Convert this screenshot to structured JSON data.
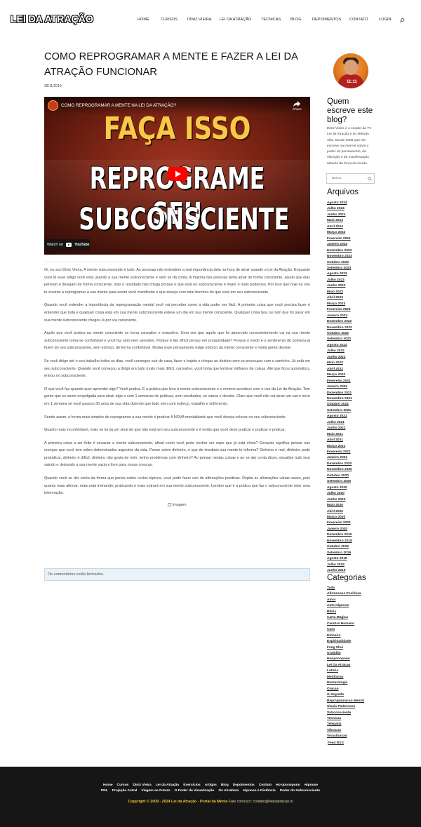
{
  "site": {
    "logo": "LEI DA ATRAÇÃO"
  },
  "nav": {
    "items": [
      "Home",
      "Cursos",
      "Diniz Vieira",
      "Lei da Atração",
      "Tecnicas",
      "Blog",
      "Depoimentos",
      "Contato",
      "Login"
    ]
  },
  "post": {
    "title": "COMO REPROGRAMAR A MENTE E FAZER A LEI DA ATRAÇÃO FUNCIONAR",
    "date": "28/11/2019"
  },
  "video": {
    "title": "COMO REPROGRAMAR A MENTE NA LEI DA ATRAÇÃO?",
    "share_label": "Share",
    "line1": "FAÇA ISSO",
    "line2": "REPROGRAME SEU",
    "line3": "SUBCONSCIENTE",
    "watch_on": "Watch on",
    "youtube": "YouTube",
    "colors": {
      "headline_yellow": "#f7c948",
      "bg_red": "#7a2414",
      "play_red": "#ff0000"
    }
  },
  "article": {
    "paragraphs": [
      "Oi, eu sou Diniz Vieira. A mente subconsciente é tudo. As pessoas não entendem a real importância dela na hora de atrair usando a Lei da Atração. Enquanto você lê esse artigo você está usando a sua mente subconsciente e nem se dá conta. A maioria das pessoas tenta atrair de forma consciente, aquilo que elas pensam e desejam de forma consciente, mas o resultado não chega porque o que está no subconsciente é maior e mais poderoso. Por isso que hoje eu vou te ensinar a reprogramar a sua mente para assim você manifestar o que deseja com total domínio do que está em seu subconsciente.",
      "Quando você entender a importância da reprogramação mental você vai perceber como a vida poder ser fácil. A primeira coisa que você precisa fazer é entender que toda e qualquer coisa está em sua mente subconsciente esteve um dia em sua mente consciente. Qualquer coisa boa ou ruim que foi parar em sua mente subconsciente chegou lá por via consciente.",
      "Aquilo que você pratica na mente consciente se torna cansativo e exaustivo. Uma vez que aquilo que foi absorvido conscientemente cai na sua mente subconsciente torna-se confortável e você faz sem nem perceber. Porque é tão difícil pensar em prosperidade? Porque o medo e o sentimento de pobreza já fluem do seu subconsciente, sem esforço, de forma confortável. Mudar esse pensamento exige esforço da mente consciente e muita gente desiste.",
      "Se você dirige até o seu trabalho todos os dias, você consegue sair de casa, fazer o trajeto e chegar ao destino sem se preocupar com o caminho. Já está em seu subconsciente. Quando você começou a dirigir era tudo muito mais difícil, cansativo, você tinha que lembrar milhares de coisas. Até que ficou automático, entrou no subconsciente.",
      "O que você faz quando quer aprender algo? Você pratica. É a prática que leva à mente subconsciente e o mesmo acontece com o uso da Lei da Atração. Tem gente que se sente empolgada para atrair algo e com 1 semanas de práticas, sem resultados, se cansa e desiste. Claro que você não vai atrair um carro novo em 1 semana se você passou 30 anos de sua vida dizendo que tudo vem com esforço, trabalho e sofrimento.",
      "Sendo assim, a forma mais simples de reprogramar a sua mente é praticar A NOVA mentalidade que você deseja colocar no seu subconsciente.",
      "Quanto mais inconfortável, mais se torna um sinal de que não está em seu subconsciente e é então que você deve praticar e praticar e praticar.",
      "A primeira coisa a ser feita é esvaziar a mente subconsciente, afinal como você pode encher um copo que já está cheio? Esvaziar significa pensar nas crenças que você tem sobre determinados aspectos da vida. Pense sobre dinheiro, o que de imediato sua mente te informa? Dinheiro é mal, dinheiro pode prejudicar, dinheiro é difícil, dinheiro não gosta de mim, tenho problemas com dinheiro? Ao pensar nestas coisas e ao se dar conta disso, visualize tudo isso saindo e deixando a sua mente vazia e livre para novas crenças.",
      "Quando você se der conta da forma que pensa sobre certos tópicos, você pode fazer uso de afirmações positivas. Repita as afirmações várias vezes, pois quanto mais afirmar, mais está treinando, praticando e mais entrará em sua mente subconsciente. Lembre que é a prática que faz o subconsciente reter uma informação."
    ],
    "image_alt": "Imagem"
  },
  "comments": {
    "closed_text": "Os comentários estão fechados."
  },
  "sidebar": {
    "author_photo_text": "11:11",
    "about_title": "Quem escreve este blog?",
    "about_text": "Diniz Vieira é o criador da TV Lei da Atração e do Método Alfa. Desde 2009 que ele escreve na internet sobre o poder do pensamento, da vibração e da manifestação através da força da mente.",
    "search_placeholder": "Busca",
    "archives_title": "Arquivos",
    "archives": [
      "Agosto 2024",
      "Julho 2024",
      "Junho 2024",
      "Maio 2024",
      "Abril 2024",
      "Março 2024",
      "Fevereiro 2024",
      "Janeiro 2024",
      "Dezembro 2023",
      "Novembro 2023",
      "Outubro 2023",
      "Setembro 2023",
      "Agosto 2023",
      "Julho 2023",
      "Junho 2023",
      "Maio 2023",
      "Abril 2023",
      "Março 2023",
      "Fevereiro 2023",
      "Janeiro 2023",
      "Dezembro 2022",
      "Novembro 2022",
      "Outubro 2022",
      "Setembro 2022",
      "Agosto 2022",
      "Julho 2022",
      "Junho 2022",
      "Maio 2022",
      "Abril 2022",
      "Março 2022",
      "Fevereiro 2022",
      "Janeiro 2022",
      "Dezembro 2021",
      "Novembro 2021",
      "Outubro 2021",
      "Setembro 2021",
      "Agosto 2021",
      "Julho 2021",
      "Junho 2021",
      "Maio 2021",
      "Abril 2021",
      "Março 2021",
      "Fevereiro 2021",
      "Janeiro 2021",
      "Dezembro 2020",
      "Novembro 2020",
      "Outubro 2020",
      "Setembro 2020",
      "Agosto 2020",
      "Julho 2020",
      "Junho 2020",
      "Maio 2020",
      "Abril 2020",
      "Março 2020",
      "Fevereiro 2020",
      "Janeiro 2020",
      "Dezembro 2019",
      "Novembro 2019",
      "Outubro 2019",
      "Setembro 2019",
      "Agosto 2019",
      "Julho 2019",
      "Junho 2019"
    ],
    "categories_title": "Categorias",
    "categories": [
      "Tudo",
      "Afirmacoes Positivas",
      "Amor",
      "Auto Hipnose",
      "Bíblia",
      "Carta Magica",
      "Cerebro Humano",
      "Cura",
      "Dinheiro",
      "Espiritualidade",
      "Feng Shui",
      "Gratidão",
      "Hooponopono",
      "Lei Da Atracao",
      "Loteria",
      "Meditacao",
      "Numerologia",
      "Oracao",
      "O Segredo",
      "Reprogramacao Mental",
      "Sinais Poderosos",
      "Subconsciente",
      "Tecnicas",
      "Telepatia",
      "Vibracao",
      "Visualizacao"
    ],
    "feed_rss": "Feed RSS"
  },
  "footer": {
    "links_row1": [
      "Home",
      "Cursos",
      "Diniz Vieira",
      "Lei da Atração",
      "Exercícios",
      "Artigos",
      "Blog",
      "Depoimentos",
      "Contato",
      "Ho'oponopono",
      "Hipnose"
    ],
    "links_row2": [
      "PNL",
      "Projeção Astral",
      "Viagem ao Futuro",
      "O Poder da Visualização",
      "Os Abraham",
      "Hipnose à Distância",
      "Poder do Subconsciente"
    ],
    "copyright": "Copyright © 2009 - 2024 Lei da Atração - Portal da Mente",
    "contact": "Fale conosco: contato@leidaatracao.tv",
    "colors": {
      "background": "#161616",
      "copyright": "#f4c430"
    }
  }
}
